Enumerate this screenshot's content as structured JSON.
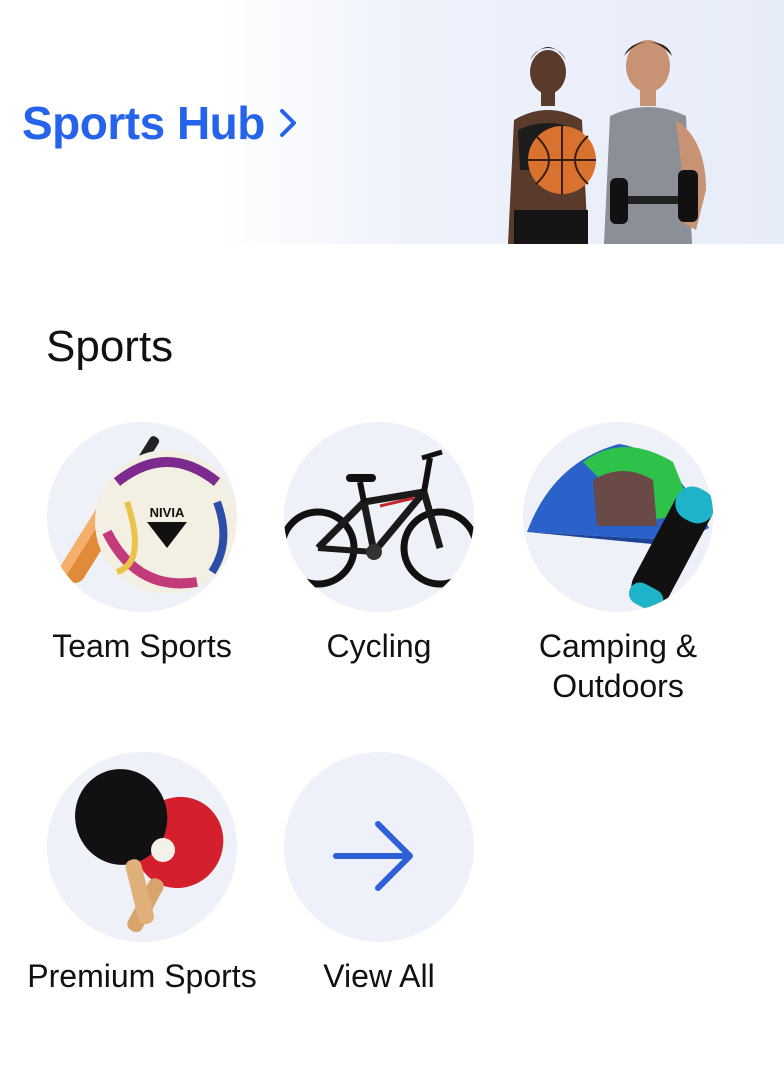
{
  "banner": {
    "title": "Sports Hub",
    "accent_color": "#2563eb",
    "chevron_icon": "chevron-right-icon"
  },
  "section": {
    "title": "Sports",
    "items": [
      {
        "label": "Team Sports",
        "icon": "cricket-bat-football-image"
      },
      {
        "label": "Cycling",
        "icon": "bicycle-image"
      },
      {
        "label": "Camping & Outdoors",
        "icon": "tent-sleeping-bag-image"
      },
      {
        "label": "Premium Sports",
        "icon": "table-tennis-paddles-image"
      },
      {
        "label": "View All",
        "icon": "arrow-right-icon"
      }
    ],
    "ball_brand": "NIVIA"
  }
}
